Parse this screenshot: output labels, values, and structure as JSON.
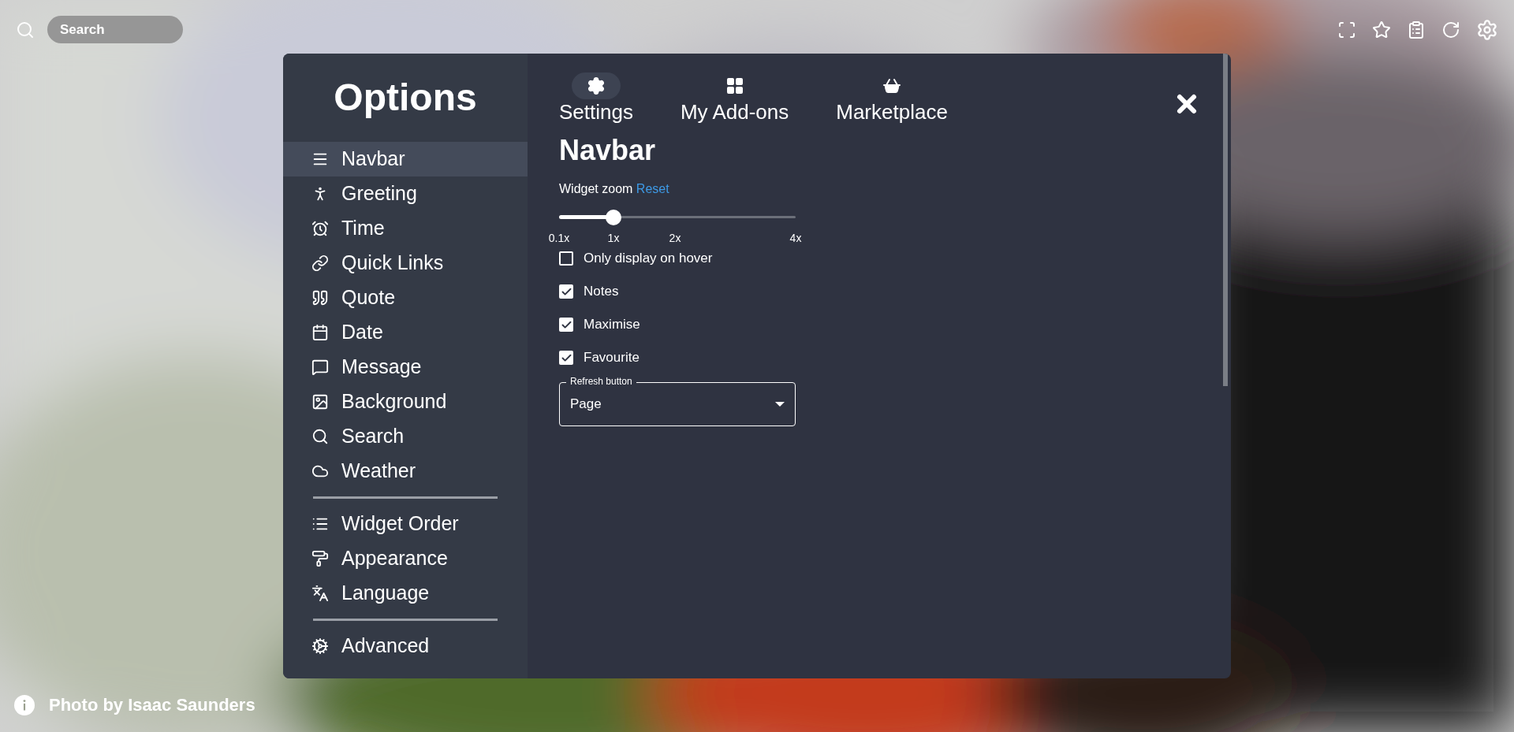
{
  "top_bar": {
    "search": {
      "placeholder": "Search"
    }
  },
  "options": {
    "title": "Options",
    "sidebar": {
      "sections": [
        {
          "items": [
            {
              "label": "Navbar",
              "selected": true
            },
            {
              "label": "Greeting",
              "selected": false
            },
            {
              "label": "Time",
              "selected": false
            },
            {
              "label": "Quick Links",
              "selected": false
            },
            {
              "label": "Quote",
              "selected": false
            },
            {
              "label": "Date",
              "selected": false
            },
            {
              "label": "Message",
              "selected": false
            },
            {
              "label": "Background",
              "selected": false
            },
            {
              "label": "Search",
              "selected": false
            },
            {
              "label": "Weather",
              "selected": false
            }
          ]
        },
        {
          "items": [
            {
              "label": "Widget Order",
              "selected": false
            },
            {
              "label": "Appearance",
              "selected": false
            },
            {
              "label": "Language",
              "selected": false
            }
          ]
        },
        {
          "items": [
            {
              "label": "Advanced",
              "selected": false
            }
          ]
        }
      ]
    },
    "tabs": [
      {
        "label": "Settings",
        "selected": true
      },
      {
        "label": "My Add-ons",
        "selected": false
      },
      {
        "label": "Marketplace",
        "selected": false
      }
    ],
    "section_title": "Navbar",
    "zoom": {
      "label": "Widget zoom",
      "reset": "Reset",
      "level": 0.23,
      "marks": [
        "0.1x",
        "1x",
        "2x",
        "4x"
      ]
    },
    "checkboxes": [
      {
        "label": "Only display on hover",
        "checked": false
      },
      {
        "label": "Notes",
        "checked": true
      },
      {
        "label": "Maximise",
        "checked": true
      },
      {
        "label": "Favourite",
        "checked": true
      }
    ],
    "select": {
      "label": "Refresh button",
      "value": "Page"
    }
  },
  "photo_credit": "Photo by Isaac Saunders"
}
